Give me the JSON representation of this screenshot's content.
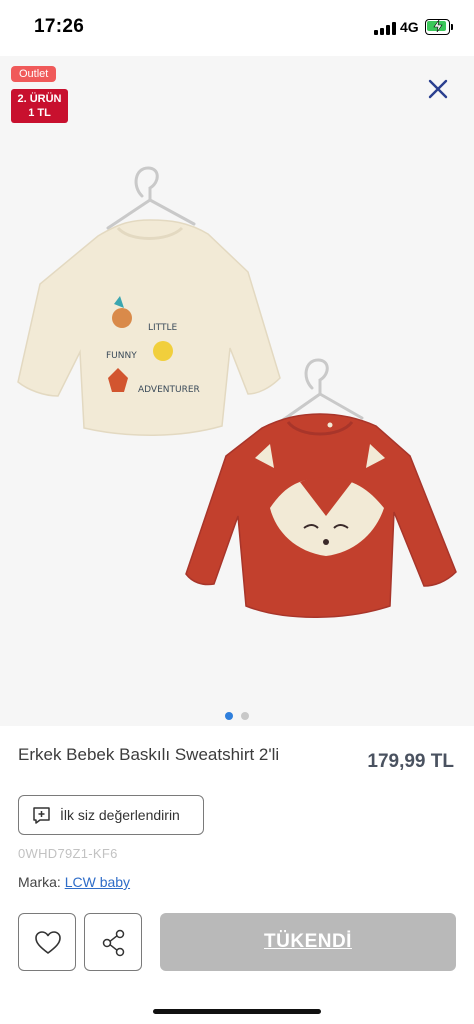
{
  "status_bar": {
    "time": "17:26",
    "network": "4G"
  },
  "gallery": {
    "outlet_badge": "Outlet",
    "promo_badge_line1": "2. ÜRÜN",
    "promo_badge_line2": "1 TL",
    "sweatshirt_print_text": [
      "LITTLE",
      "FUNNY",
      "ADVENTURER"
    ],
    "slide_count": 2,
    "active_slide": 1
  },
  "product": {
    "title": "Erkek Bebek Baskılı Sweatshirt 2'li",
    "price": "179,99 TL",
    "review_button": "İlk siz değerlendirin",
    "sku": "0WHD79Z1-KF6",
    "brand_label": "Marka:",
    "brand_name": "LCW baby"
  },
  "actions": {
    "soldout_label": "TÜKENDİ"
  },
  "colors": {
    "accent_blue": "#2f7fdc",
    "outlet_badge": "#f05a5a",
    "promo_badge": "#c8102e",
    "soldout_button": "#b9b9b9",
    "sweatshirt_cream": "#f2ead6",
    "sweatshirt_rust": "#c2402d"
  }
}
